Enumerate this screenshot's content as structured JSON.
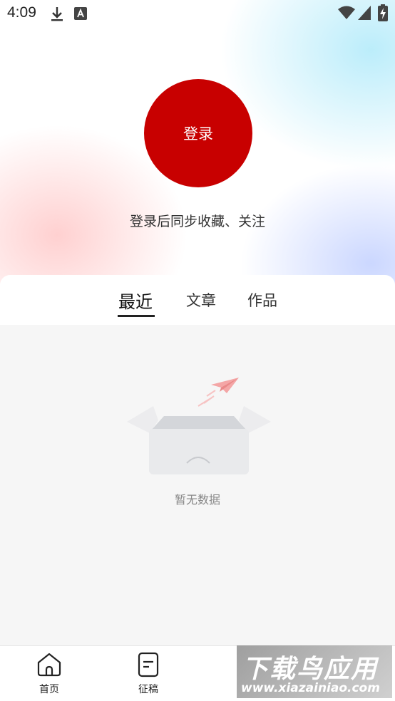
{
  "status_bar": {
    "time": "4:09",
    "icons": [
      "download-icon",
      "a-keyboard-icon",
      "wifi-icon",
      "signal-icon",
      "battery-charging-icon"
    ]
  },
  "login": {
    "button_label": "登录",
    "hint": "登录后同步收藏、关注",
    "button_color": "#c80000"
  },
  "tabs": [
    {
      "label": "最近",
      "active": true
    },
    {
      "label": "文章",
      "active": false
    },
    {
      "label": "作品",
      "active": false
    }
  ],
  "empty_state": {
    "text": "暂无数据",
    "icon": "empty-box-paper-plane-icon"
  },
  "bottom_nav": [
    {
      "label": "首页",
      "icon": "home-icon"
    },
    {
      "label": "征稿",
      "icon": "document-icon"
    }
  ],
  "watermark": {
    "title": "下载鸟应用",
    "subtitle": "www.xiazainiao.com"
  }
}
